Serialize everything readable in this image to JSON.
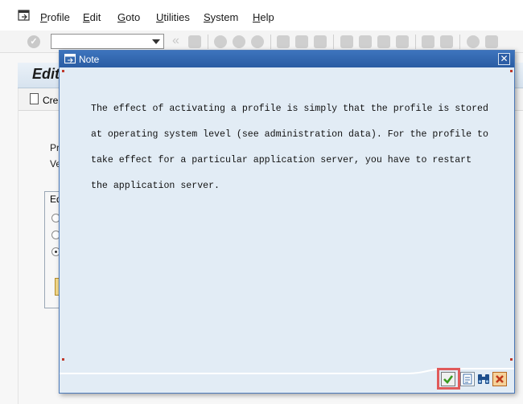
{
  "menubar": {
    "items": [
      "Profile",
      "Edit",
      "Goto",
      "Utilities",
      "System",
      "Help"
    ]
  },
  "toolbar": {
    "command_field_value": ""
  },
  "background": {
    "header_title": "Edit",
    "app_button_label": "Cre",
    "field_label_1": "Pr",
    "field_label_2": "Ve",
    "group_title": "Ed"
  },
  "dialog": {
    "title": "Note",
    "message_lines": [
      "The effect of activating a profile is simply that the profile is stored",
      "at operating system level (see administration data). For the profile to",
      "take effect for a particular application server, you have to restart",
      "the application server."
    ]
  },
  "colors": {
    "dialog_titlebar": "#2f64ad",
    "dialog_background": "#e2ecf5",
    "highlight": "#e05a5a",
    "checkmark": "#3a9a1f"
  }
}
